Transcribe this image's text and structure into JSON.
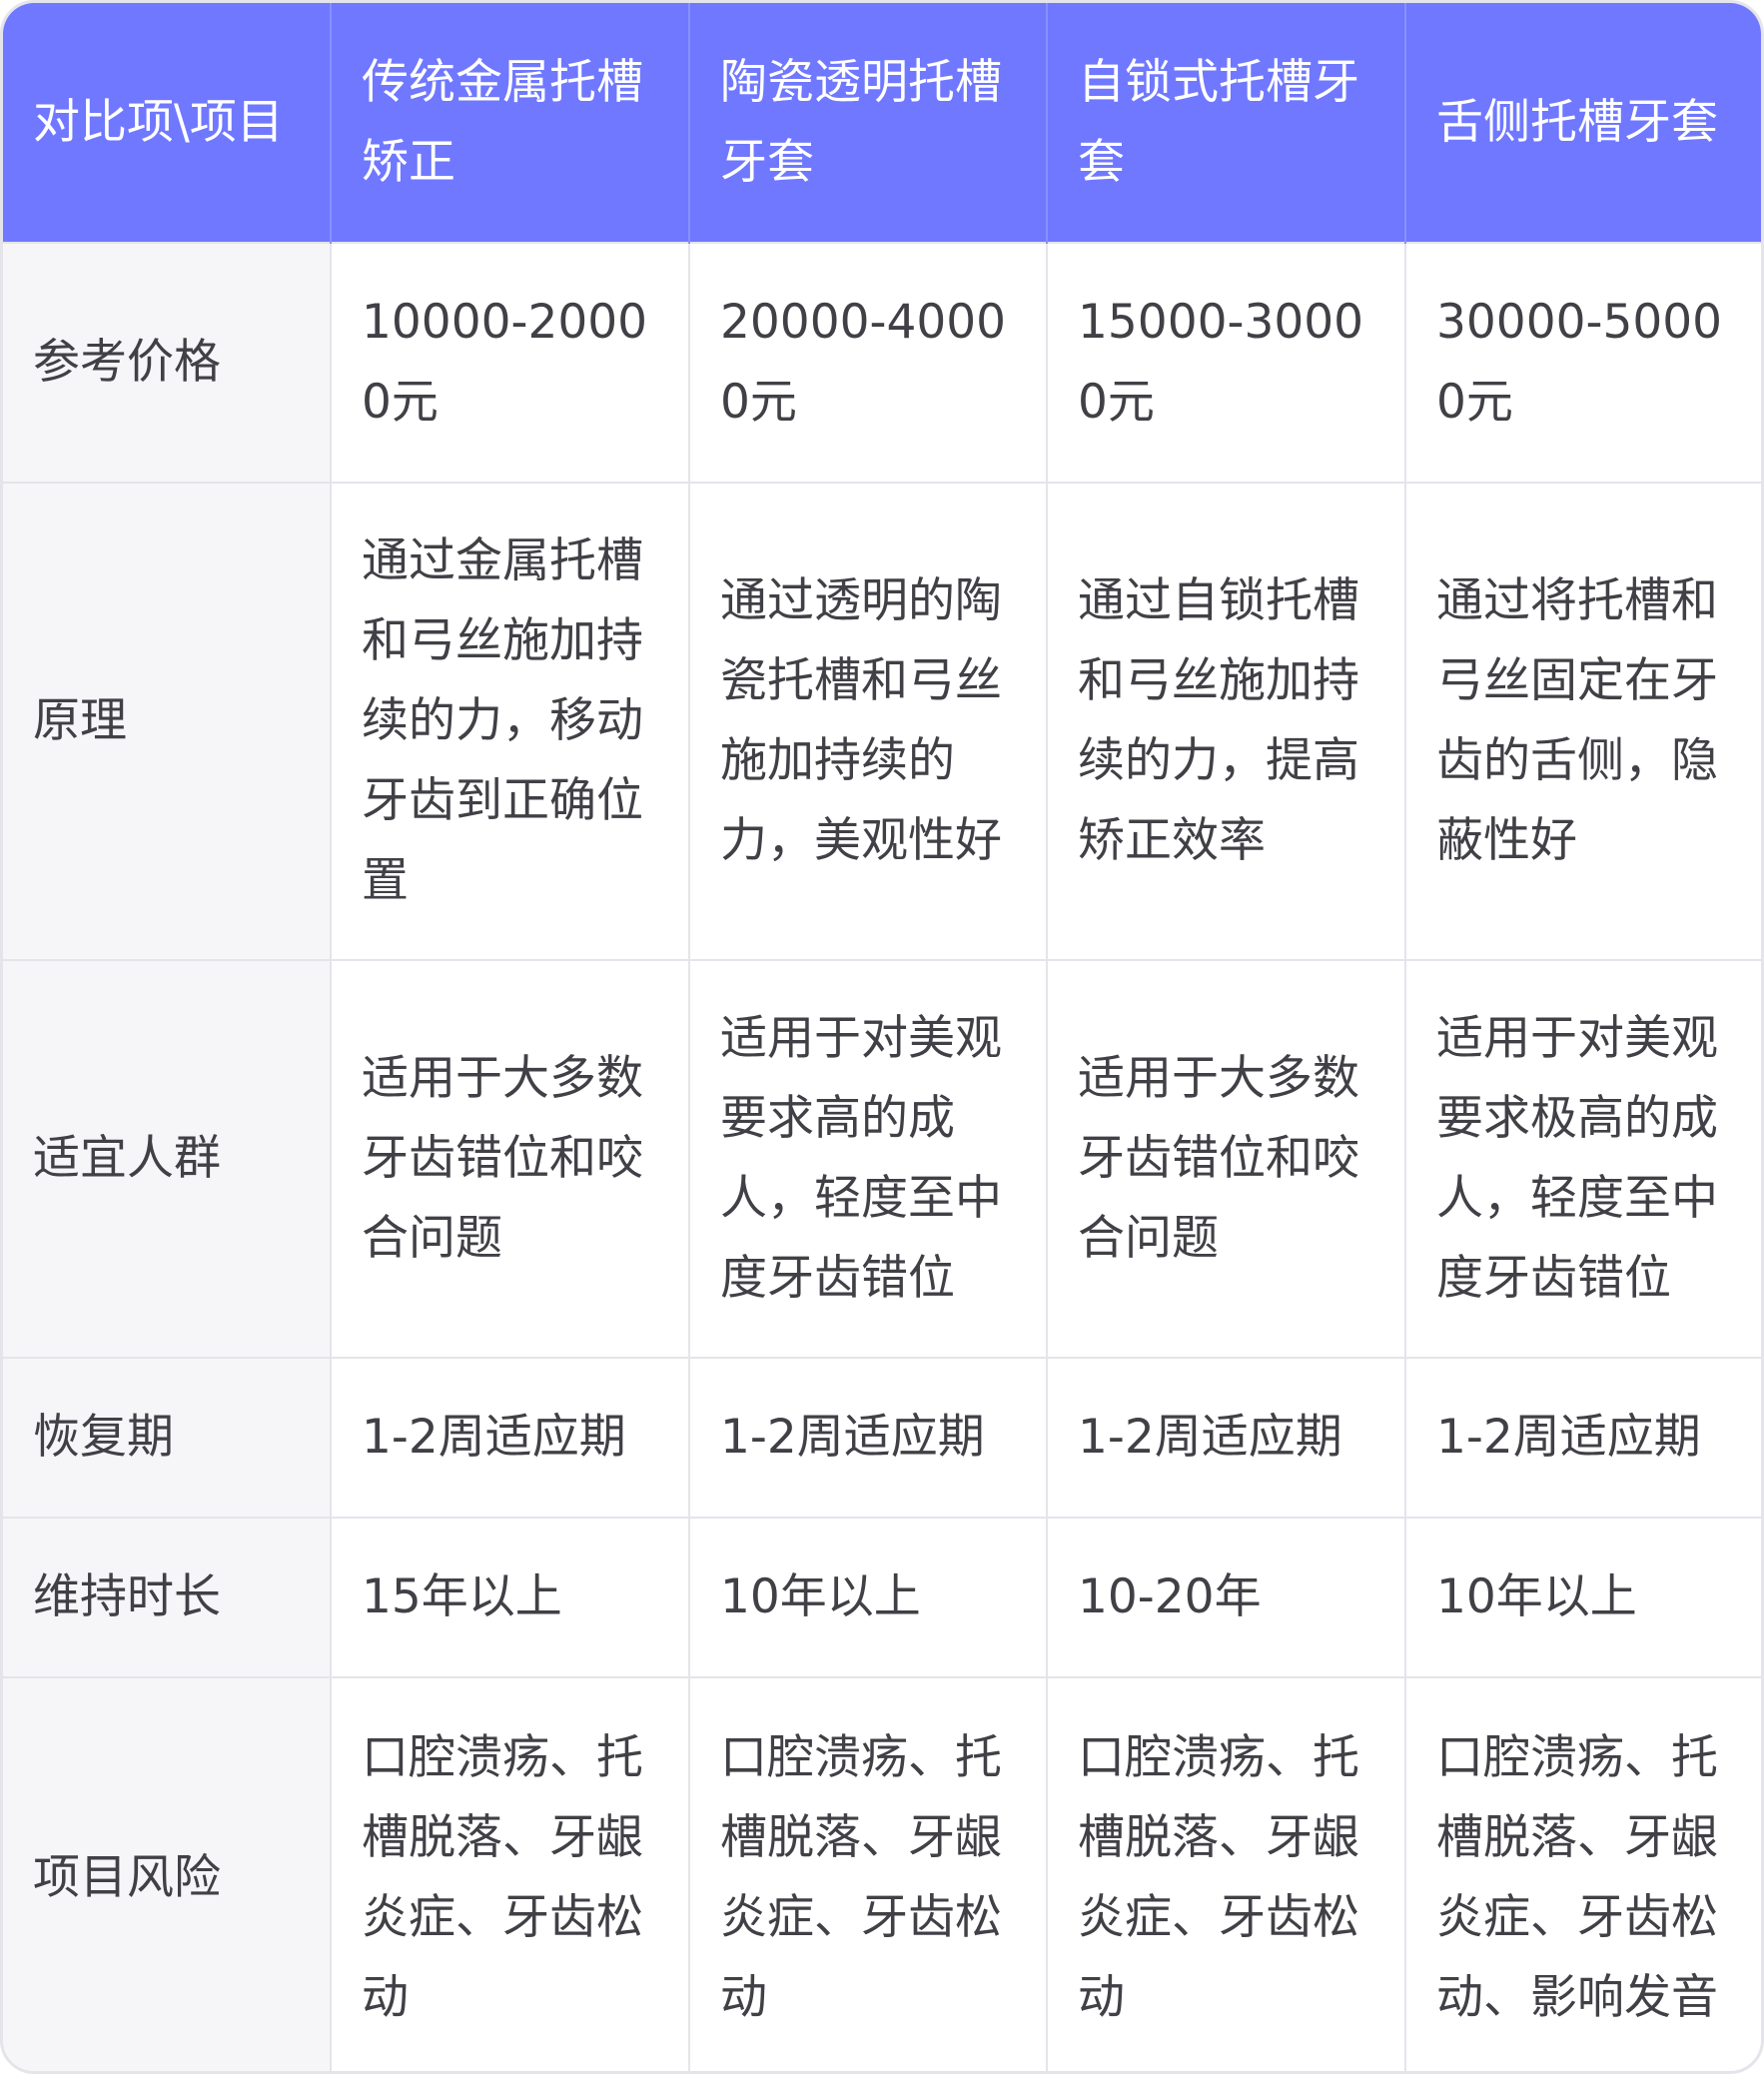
{
  "table": {
    "headers": [
      "对比项\\项目",
      "传统金属托槽矫正",
      "陶瓷透明托槽牙套",
      "自锁式托槽牙套",
      "舌侧托槽牙套"
    ],
    "rows": [
      {
        "label": "参考价格",
        "cells": [
          "10000-20000元",
          "20000-40000元",
          "15000-30000元",
          "30000-50000元"
        ]
      },
      {
        "label": "原理",
        "cells": [
          "通过金属托槽和弓丝施加持续的力，移动牙齿到正确位置",
          "通过透明的陶瓷托槽和弓丝施加持续的力，美观性好",
          "通过自锁托槽和弓丝施加持续的力，提高矫正效率",
          "通过将托槽和弓丝固定在牙齿的舌侧，隐蔽性好"
        ]
      },
      {
        "label": "适宜人群",
        "cells": [
          "适用于大多数牙齿错位和咬合问题",
          "适用于对美观要求高的成人，轻度至中度牙齿错位",
          "适用于大多数牙齿错位和咬合问题",
          "适用于对美观要求极高的成人，轻度至中度牙齿错位"
        ]
      },
      {
        "label": "恢复期",
        "cells": [
          "1-2周适应期",
          "1-2周适应期",
          "1-2周适应期",
          "1-2周适应期"
        ]
      },
      {
        "label": "维持时长",
        "cells": [
          "15年以上",
          "10年以上",
          "10-20年",
          "10年以上"
        ]
      },
      {
        "label": "项目风险",
        "cells": [
          "口腔溃疡、托槽脱落、牙龈炎症、牙齿松动",
          "口腔溃疡、托槽脱落、牙龈炎症、牙齿松动",
          "口腔溃疡、托槽脱落、牙龈炎症、牙齿松动",
          "口腔溃疡、托槽脱落、牙龈炎症、牙齿松动、影响发音"
        ]
      }
    ]
  },
  "colors": {
    "header_bg": "#6f78ff",
    "header_text": "#ffffff",
    "label_bg": "#f6f6f8",
    "border": "#e4e4ea",
    "body_text": "#404046"
  }
}
